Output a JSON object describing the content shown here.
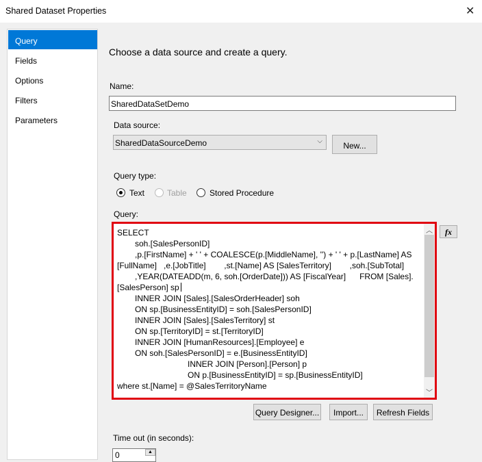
{
  "window": {
    "title": "Shared Dataset Properties",
    "close": "✕"
  },
  "nav": {
    "items": [
      "Query",
      "Fields",
      "Options",
      "Filters",
      "Parameters"
    ]
  },
  "main": {
    "heading": "Choose a data source and create a query.",
    "name_label": "Name:",
    "name_value": "SharedDataSetDemo",
    "datasource_label": "Data source:",
    "datasource_value": "SharedDataSourceDemo",
    "new_button": "New...",
    "querytype_label": "Query type:",
    "querytypes": [
      "Text",
      "Table",
      "Stored Procedure"
    ],
    "query_label": "Query:",
    "fx": "fx",
    "query_lines": [
      "SELECT",
      "soh.[SalesPersonID]",
      ",p.[FirstName] + ' ' + COALESCE(p.[MiddleName], '') + ' ' + p.[LastName] AS",
      "[FullName]   ,e.[JobTitle]        ,st.[Name] AS [SalesTerritory]        ,soh.[SubTotal]",
      ",YEAR(DATEADD(m, 6, soh.[OrderDate])) AS [FiscalYear]      FROM [Sales].",
      "[SalesPerson] sp",
      "INNER JOIN [Sales].[SalesOrderHeader] soh",
      "ON sp.[BusinessEntityID] = soh.[SalesPersonID]",
      "INNER JOIN [Sales].[SalesTerritory] st",
      "ON sp.[TerritoryID] = st.[TerritoryID]",
      "INNER JOIN [HumanResources].[Employee] e",
      "ON soh.[SalesPersonID] = e.[BusinessEntityID]",
      "INNER JOIN [Person].[Person] p",
      "ON p.[BusinessEntityID] = sp.[BusinessEntityID]",
      "where st.[Name] = @SalesTerritoryName"
    ],
    "buttons": {
      "designer": "Query Designer...",
      "import": "Import...",
      "refresh": "Refresh Fields"
    },
    "timeout_label": "Time out (in seconds):",
    "timeout_value": "0"
  }
}
